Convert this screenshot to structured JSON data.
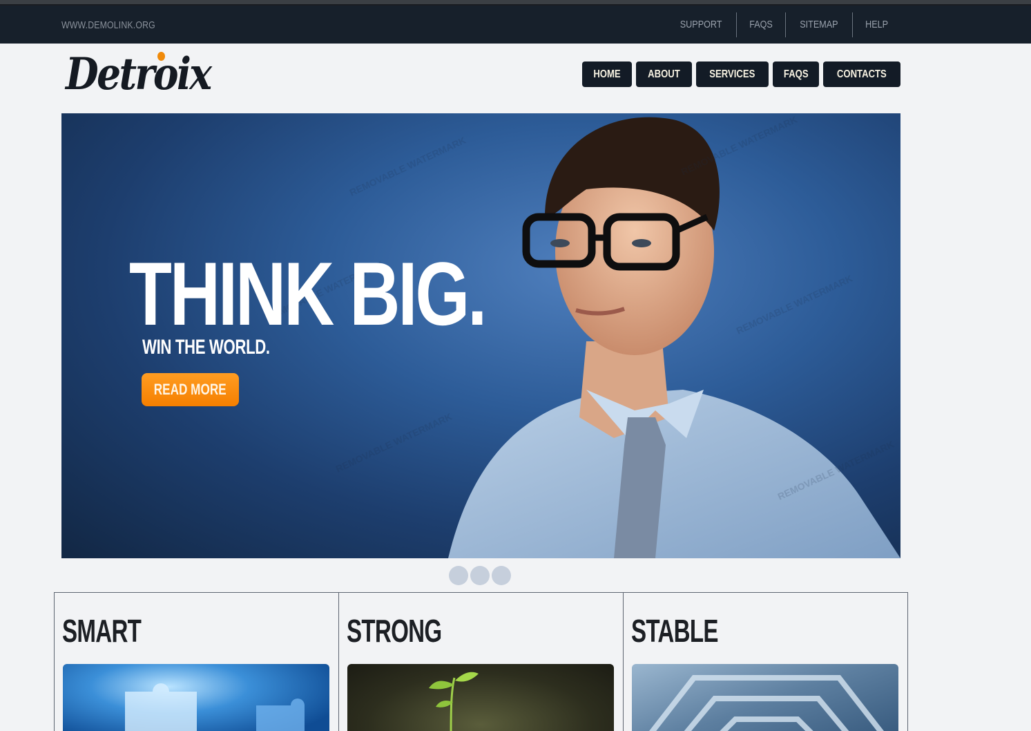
{
  "topbar": {
    "url": "WWW.DEMOLINK.ORG",
    "links": [
      "SUPPORT",
      "FAQS",
      "SITEMAP",
      "HELP"
    ]
  },
  "logo": {
    "text": "Detroix"
  },
  "nav": {
    "items": [
      "HOME",
      "ABOUT",
      "SERVICES",
      "FAQS",
      "CONTACTS"
    ]
  },
  "hero": {
    "headline": "THINK BIG.",
    "subheadline": "WIN THE WORLD.",
    "cta_label": "READ MORE",
    "watermark": "REMOVABLE WATERMARK"
  },
  "slider": {
    "dot_count": 3,
    "active_index": 0
  },
  "features": [
    {
      "title": "SMART"
    },
    {
      "title": "STRONG"
    },
    {
      "title": "STABLE"
    }
  ],
  "colors": {
    "topbar_bg": "#17202b",
    "nav_bg": "#131b26",
    "accent": "#f57f00",
    "page_bg": "#f2f3f5"
  },
  "icons": [
    "logo-dot",
    "slider-dot"
  ]
}
